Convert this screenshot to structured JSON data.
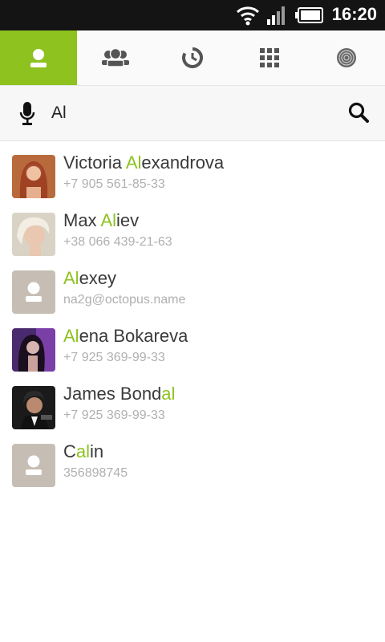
{
  "status_bar": {
    "time": "16:20"
  },
  "tabs": [
    {
      "name": "contacts",
      "icon": "person-icon",
      "active": true
    },
    {
      "name": "groups",
      "icon": "group-icon",
      "active": false
    },
    {
      "name": "history",
      "icon": "history-icon",
      "active": false
    },
    {
      "name": "dialpad",
      "icon": "dialpad-icon",
      "active": false
    },
    {
      "name": "octopus",
      "icon": "octopus-logo-icon",
      "active": false
    }
  ],
  "search": {
    "value": "Al"
  },
  "colors": {
    "accent": "#8dc21f",
    "text": "#3a3a3a",
    "secondary": "#b0b0b0"
  },
  "contacts": [
    {
      "pre": "Victoria ",
      "match": "Al",
      "post": "exandrova",
      "detail": "+7 905 561-85-33",
      "avatar": "photo"
    },
    {
      "pre": "Max ",
      "match": "Al",
      "post": "iev",
      "detail": "+38 066 439-21-63",
      "avatar": "photo"
    },
    {
      "pre": "",
      "match": "Al",
      "post": "exey",
      "detail": "na2g@octopus.name",
      "avatar": "placeholder"
    },
    {
      "pre": "",
      "match": "Al",
      "post": "ena Bokareva",
      "detail": "+7 925 369-99-33",
      "avatar": "photo"
    },
    {
      "pre": "James Bond",
      "match": "al",
      "post": "",
      "detail": "+7 925 369-99-33",
      "avatar": "photo"
    },
    {
      "pre": "C",
      "match": "al",
      "post": "in",
      "detail": "356898745",
      "avatar": "placeholder"
    }
  ]
}
